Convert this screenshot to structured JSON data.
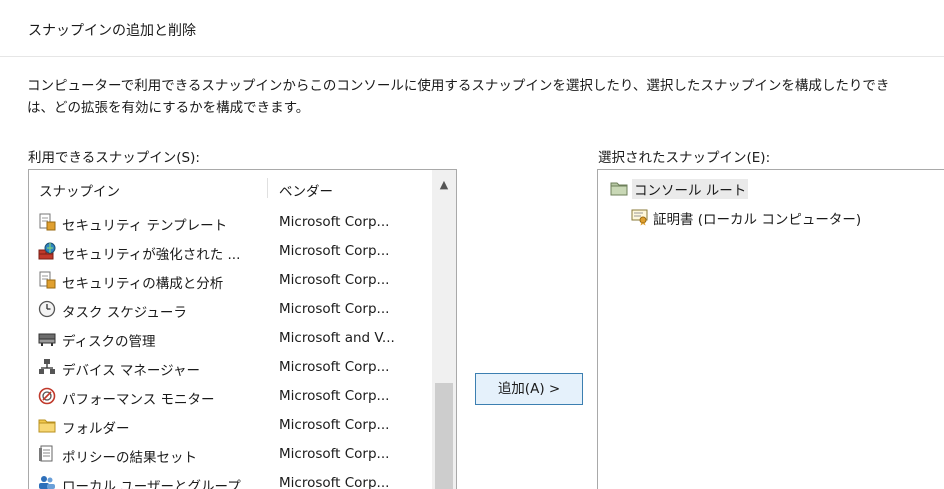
{
  "dialog": {
    "title": "スナップインの追加と削除",
    "description_line1": "コンピューターで利用できるスナップインからこのコンソールに使用するスナップインを選択したり、選択したスナップインを構成したりでき",
    "description_line2": "は、どの拡張を有効にするかを構成できます。"
  },
  "available": {
    "label": "利用できるスナップイン(S):",
    "columns": {
      "name": "スナップイン",
      "vendor": "ベンダー"
    },
    "rows": [
      {
        "name": "セキュリティ テンプレート",
        "vendor": "Microsoft Corp...",
        "icon": "security-template-icon"
      },
      {
        "name": "セキュリティが強化された ...",
        "vendor": "Microsoft Corp...",
        "icon": "firewall-icon"
      },
      {
        "name": "セキュリティの構成と分析",
        "vendor": "Microsoft Corp...",
        "icon": "security-config-icon"
      },
      {
        "name": "タスク スケジューラ",
        "vendor": "Microsoft Corp...",
        "icon": "clock-icon"
      },
      {
        "name": "ディスクの管理",
        "vendor": "Microsoft and V...",
        "icon": "disk-icon"
      },
      {
        "name": "デバイス マネージャー",
        "vendor": "Microsoft Corp...",
        "icon": "device-manager-icon"
      },
      {
        "name": "パフォーマンス モニター",
        "vendor": "Microsoft Corp...",
        "icon": "performance-icon"
      },
      {
        "name": "フォルダー",
        "vendor": "Microsoft Corp...",
        "icon": "folder-icon"
      },
      {
        "name": "ポリシーの結果セット",
        "vendor": "Microsoft Corp...",
        "icon": "policy-icon"
      },
      {
        "name": "ローカル ユーザーとグループ",
        "vendor": "Microsoft Corp...",
        "icon": "users-icon"
      }
    ]
  },
  "add_button": {
    "label": "追加(A) >"
  },
  "selected": {
    "label": "選択されたスナップイン(E):",
    "root": {
      "label": "コンソール ルート",
      "icon": "console-root-icon"
    },
    "child": {
      "label": "証明書 (ローカル コンピューター)",
      "icon": "certificate-icon"
    }
  },
  "colors": {
    "button_border": "#3c7fb1",
    "button_bg": "#e5f1fb",
    "list_border": "#a9a9a9"
  }
}
